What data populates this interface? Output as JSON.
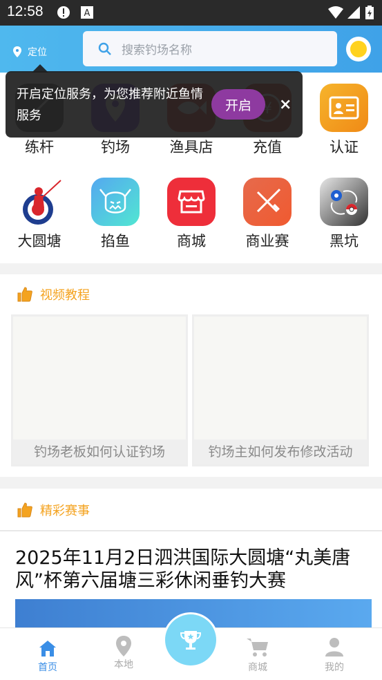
{
  "status": {
    "time": "12:58",
    "icons": [
      "alert-icon",
      "a-icon",
      "wifi-icon",
      "signal-icon",
      "battery-icon"
    ]
  },
  "header": {
    "location_label": "定位",
    "search_placeholder": "搜索钓场名称"
  },
  "tooltip": {
    "message": "开启定位服务，为您推荐附近鱼情服务",
    "open_label": "开启",
    "close_label": "×"
  },
  "grid": [
    {
      "label": "练杆",
      "icon": "rod-icon",
      "color": "#666666"
    },
    {
      "label": "钓场",
      "icon": "pin-icon",
      "color": "#7b4be0"
    },
    {
      "label": "渔具店",
      "icon": "fish-icon",
      "color": "#e0533f"
    },
    {
      "label": "充值",
      "icon": "yen-icon",
      "color": "#d84c3c"
    },
    {
      "label": "认证",
      "icon": "id-card-icon",
      "color": "#f59c1a"
    },
    {
      "label": "大圆塘",
      "icon": "fisherman-logo-icon",
      "color": "#ffffff"
    },
    {
      "label": "掐鱼",
      "icon": "viking-icon",
      "color": "#5ad3e6"
    },
    {
      "label": "商城",
      "icon": "shop-icon",
      "color": "#ee2e3a"
    },
    {
      "label": "商业赛",
      "icon": "swords-icon",
      "color": "#ea5a3f"
    },
    {
      "label": "黑坑",
      "icon": "pokeball-icon",
      "color": "#333333"
    }
  ],
  "videos": {
    "title": "视频教程",
    "items": [
      {
        "caption": "钓场老板如何认证钓场"
      },
      {
        "caption": "钓场主如何发布修改活动"
      }
    ]
  },
  "events": {
    "title": "精彩赛事",
    "headline": "2025年11月2日泗洪国际大圆塘“丸美唐风”杯第六届塘三彩休闲垂钓大赛"
  },
  "tabbar": [
    {
      "label": "首页",
      "icon": "home-icon",
      "active": true
    },
    {
      "label": "本地",
      "icon": "location-icon",
      "active": false
    },
    {
      "label": "",
      "icon": "trophy-icon",
      "active": false
    },
    {
      "label": "商城",
      "icon": "cart-icon",
      "active": false
    },
    {
      "label": "我的",
      "icon": "person-icon",
      "active": false
    }
  ],
  "colors": {
    "accent": "#3fa2e8",
    "section_title": "#f4a320",
    "active_tab": "#3a8ee6"
  }
}
